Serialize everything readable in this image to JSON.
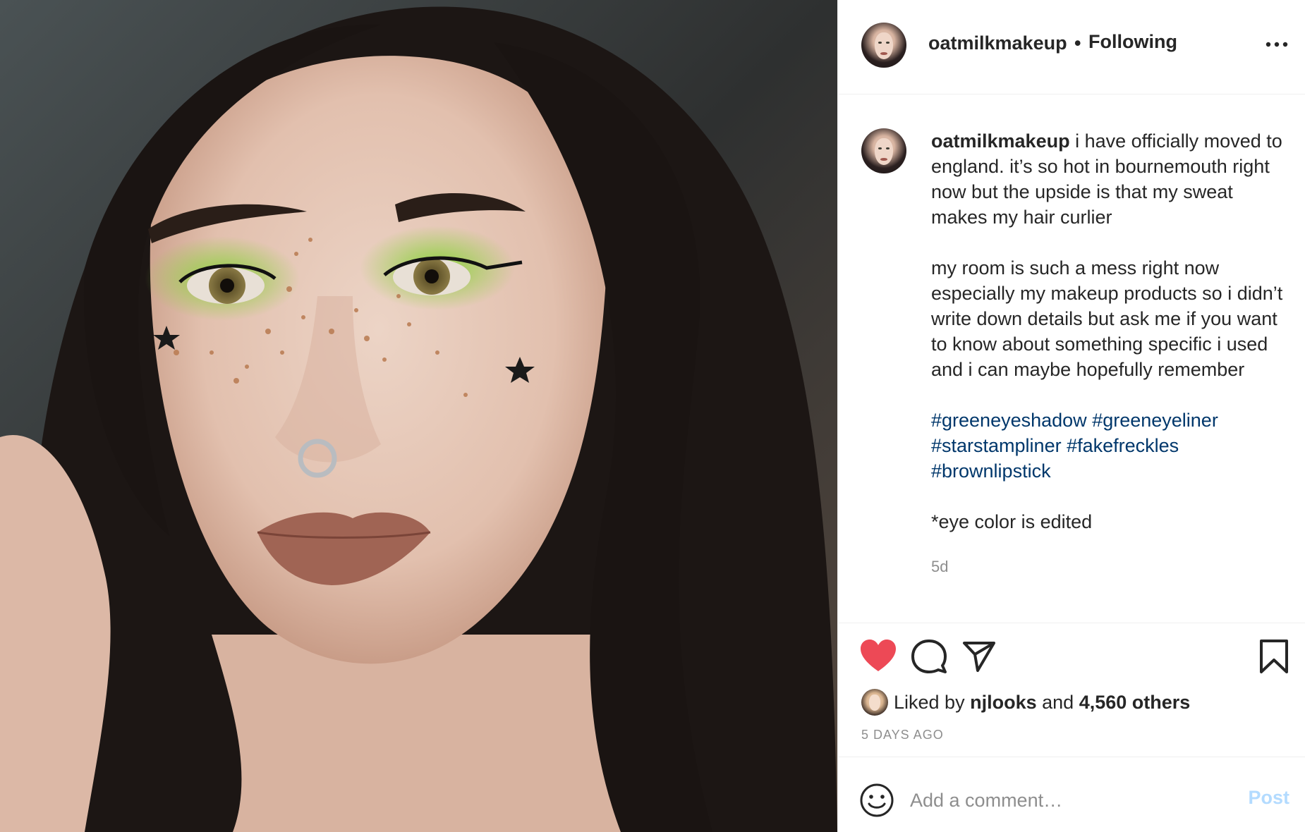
{
  "header": {
    "username": "oatmilkmakeup",
    "separator": "•",
    "follow_status": "Following",
    "more_icon": "more-horizontal-icon"
  },
  "caption": {
    "username": "oatmilkmakeup",
    "paragraph1": "i have officially moved to england. it’s so hot in bournemouth right now but the upside is that my sweat makes my hair curlier",
    "paragraph2": "my room is such a mess right now especially my makeup products so i didn’t write down details but ask me if you want to know about something specific i used and i can maybe hopefully remember",
    "hashtags": [
      "#greeneyeshadow",
      "#greeneyeliner",
      "#starstampliner",
      "#fakefreckles",
      "#brownlipstick"
    ],
    "note": "*eye color is edited",
    "time": "5d"
  },
  "actions": {
    "like_icon": "heart-icon",
    "comment_icon": "comment-icon",
    "share_icon": "share-icon",
    "save_icon": "bookmark-icon",
    "liked": true,
    "like_color": "#ed4956"
  },
  "likes": {
    "prefix": "Liked by",
    "liker": "njlooks",
    "joiner": "and",
    "others": "4,560 others"
  },
  "date": "5 DAYS AGO",
  "comment": {
    "placeholder": "Add a comment…",
    "post_label": "Post",
    "smiley_icon": "smiley-icon"
  }
}
